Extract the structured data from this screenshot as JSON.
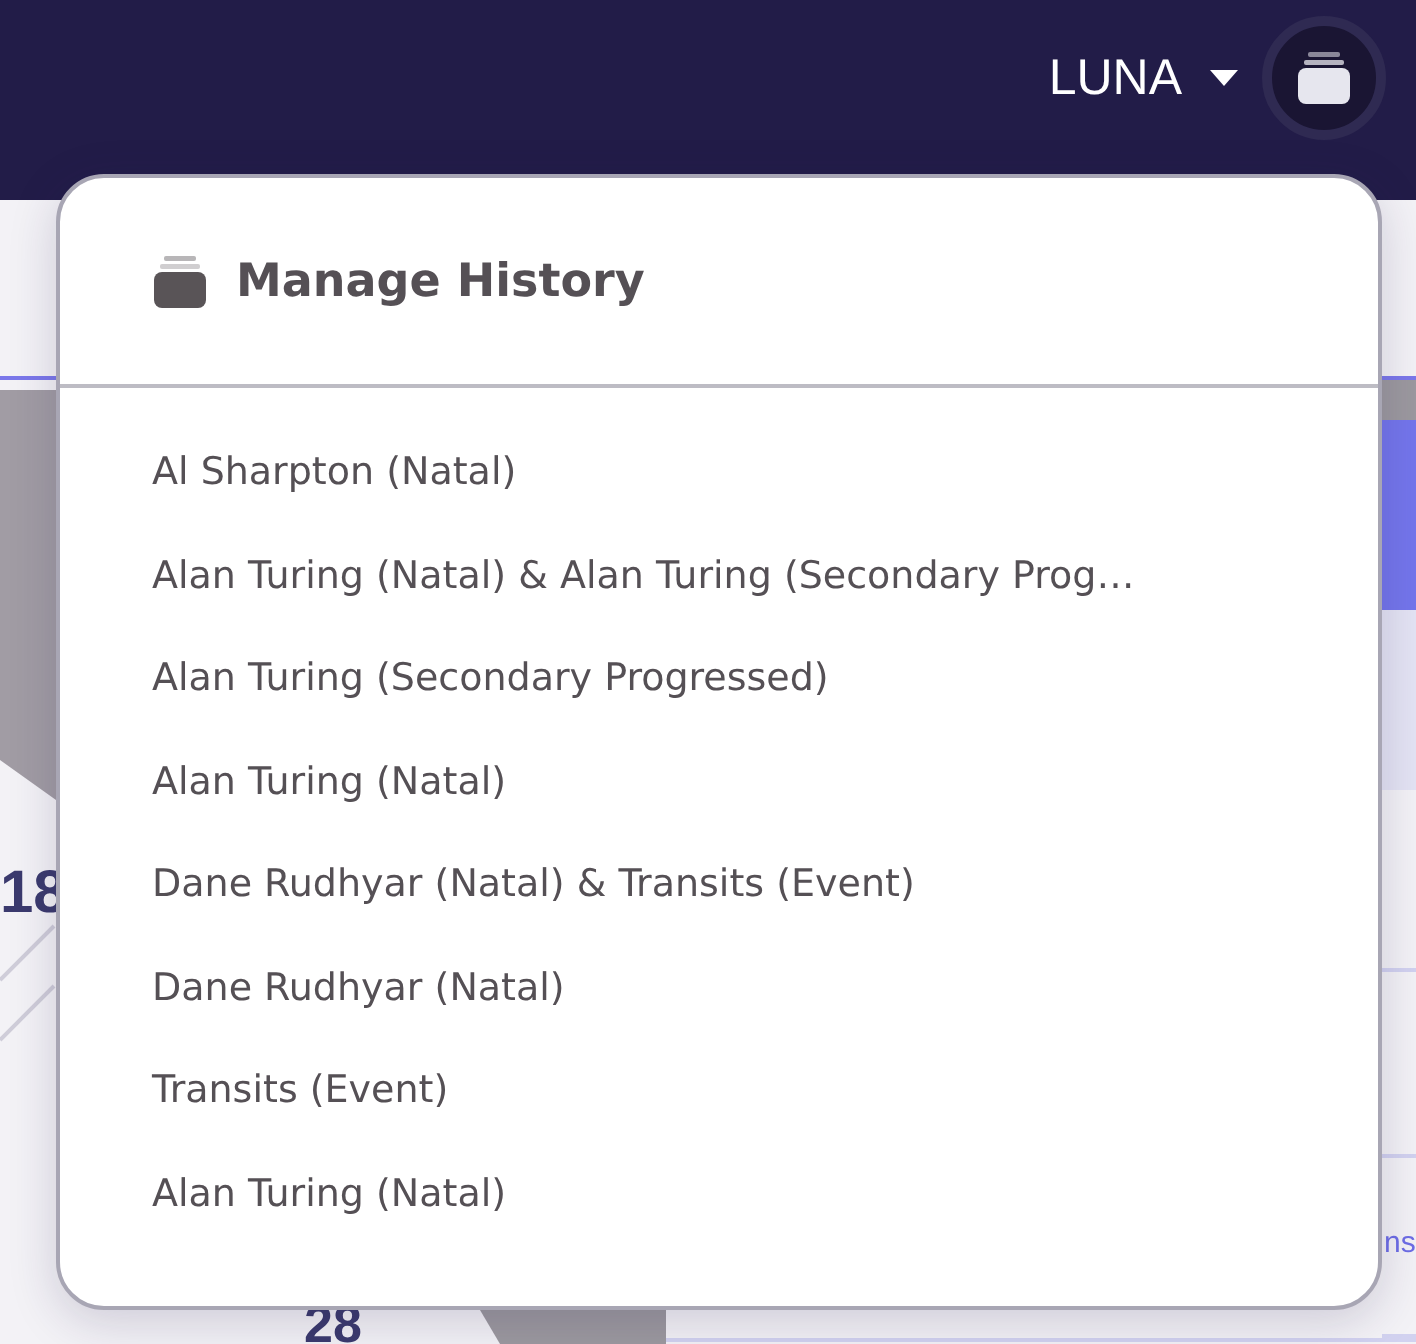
{
  "header": {
    "user_menu": "LUNA"
  },
  "background": {
    "chart_labels": [
      "18",
      "28"
    ],
    "side_link": "ns"
  },
  "history_menu": {
    "title": "Manage History",
    "items": [
      "Al Sharpton (Natal)",
      "Alan Turing (Natal) & Alan Turing (Secondary Prog…",
      "Alan Turing (Secondary Progressed)",
      "Alan Turing (Natal)",
      "Dane Rudhyar (Natal) & Transits (Event)",
      "Dane Rudhyar (Natal)",
      "Transits (Event)",
      "Alan Turing (Natal)"
    ]
  }
}
